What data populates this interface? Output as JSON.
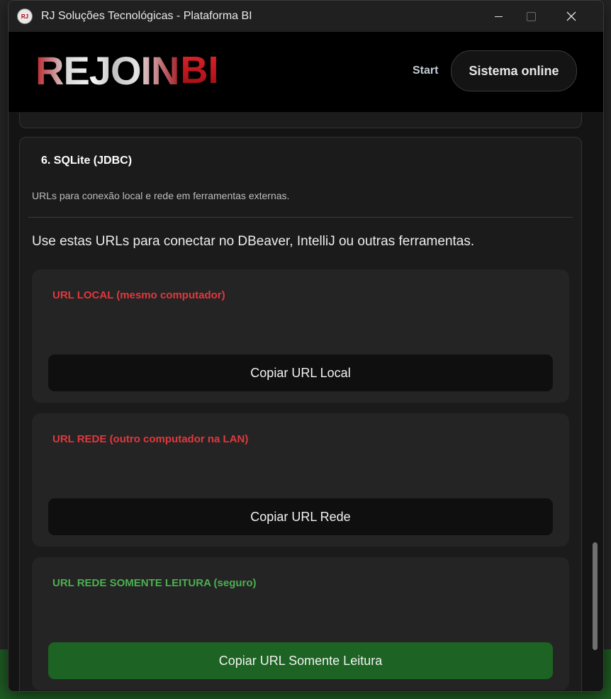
{
  "window": {
    "title": "RJ Soluções Tecnológicas - Plataforma BI",
    "icon_text": "RJ"
  },
  "header": {
    "logo_main": "REJOIN",
    "logo_accent": "BI",
    "start_link": "Start",
    "status": "Sistema online"
  },
  "section": {
    "title": "6. SQLite (JDBC)",
    "subtitle": "URLs para conexão local e rede em ferramentas externas.",
    "intro": "Use estas URLs para conectar no DBeaver, IntelliJ ou outras ferramentas."
  },
  "urls": [
    {
      "label": "URL LOCAL (mesmo computador)",
      "value": "",
      "button": "Copiar URL Local"
    },
    {
      "label": "URL REDE (outro computador na LAN)",
      "value": "",
      "button": "Copiar URL Rede"
    },
    {
      "label": "URL REDE SOMENTE LEITURA (seguro)",
      "value": "",
      "button": "Copiar URL Somente Leitura"
    }
  ],
  "colors": {
    "label_red": "#e0383e",
    "label_green": "#4caf50",
    "button_green": "#1d6323"
  }
}
